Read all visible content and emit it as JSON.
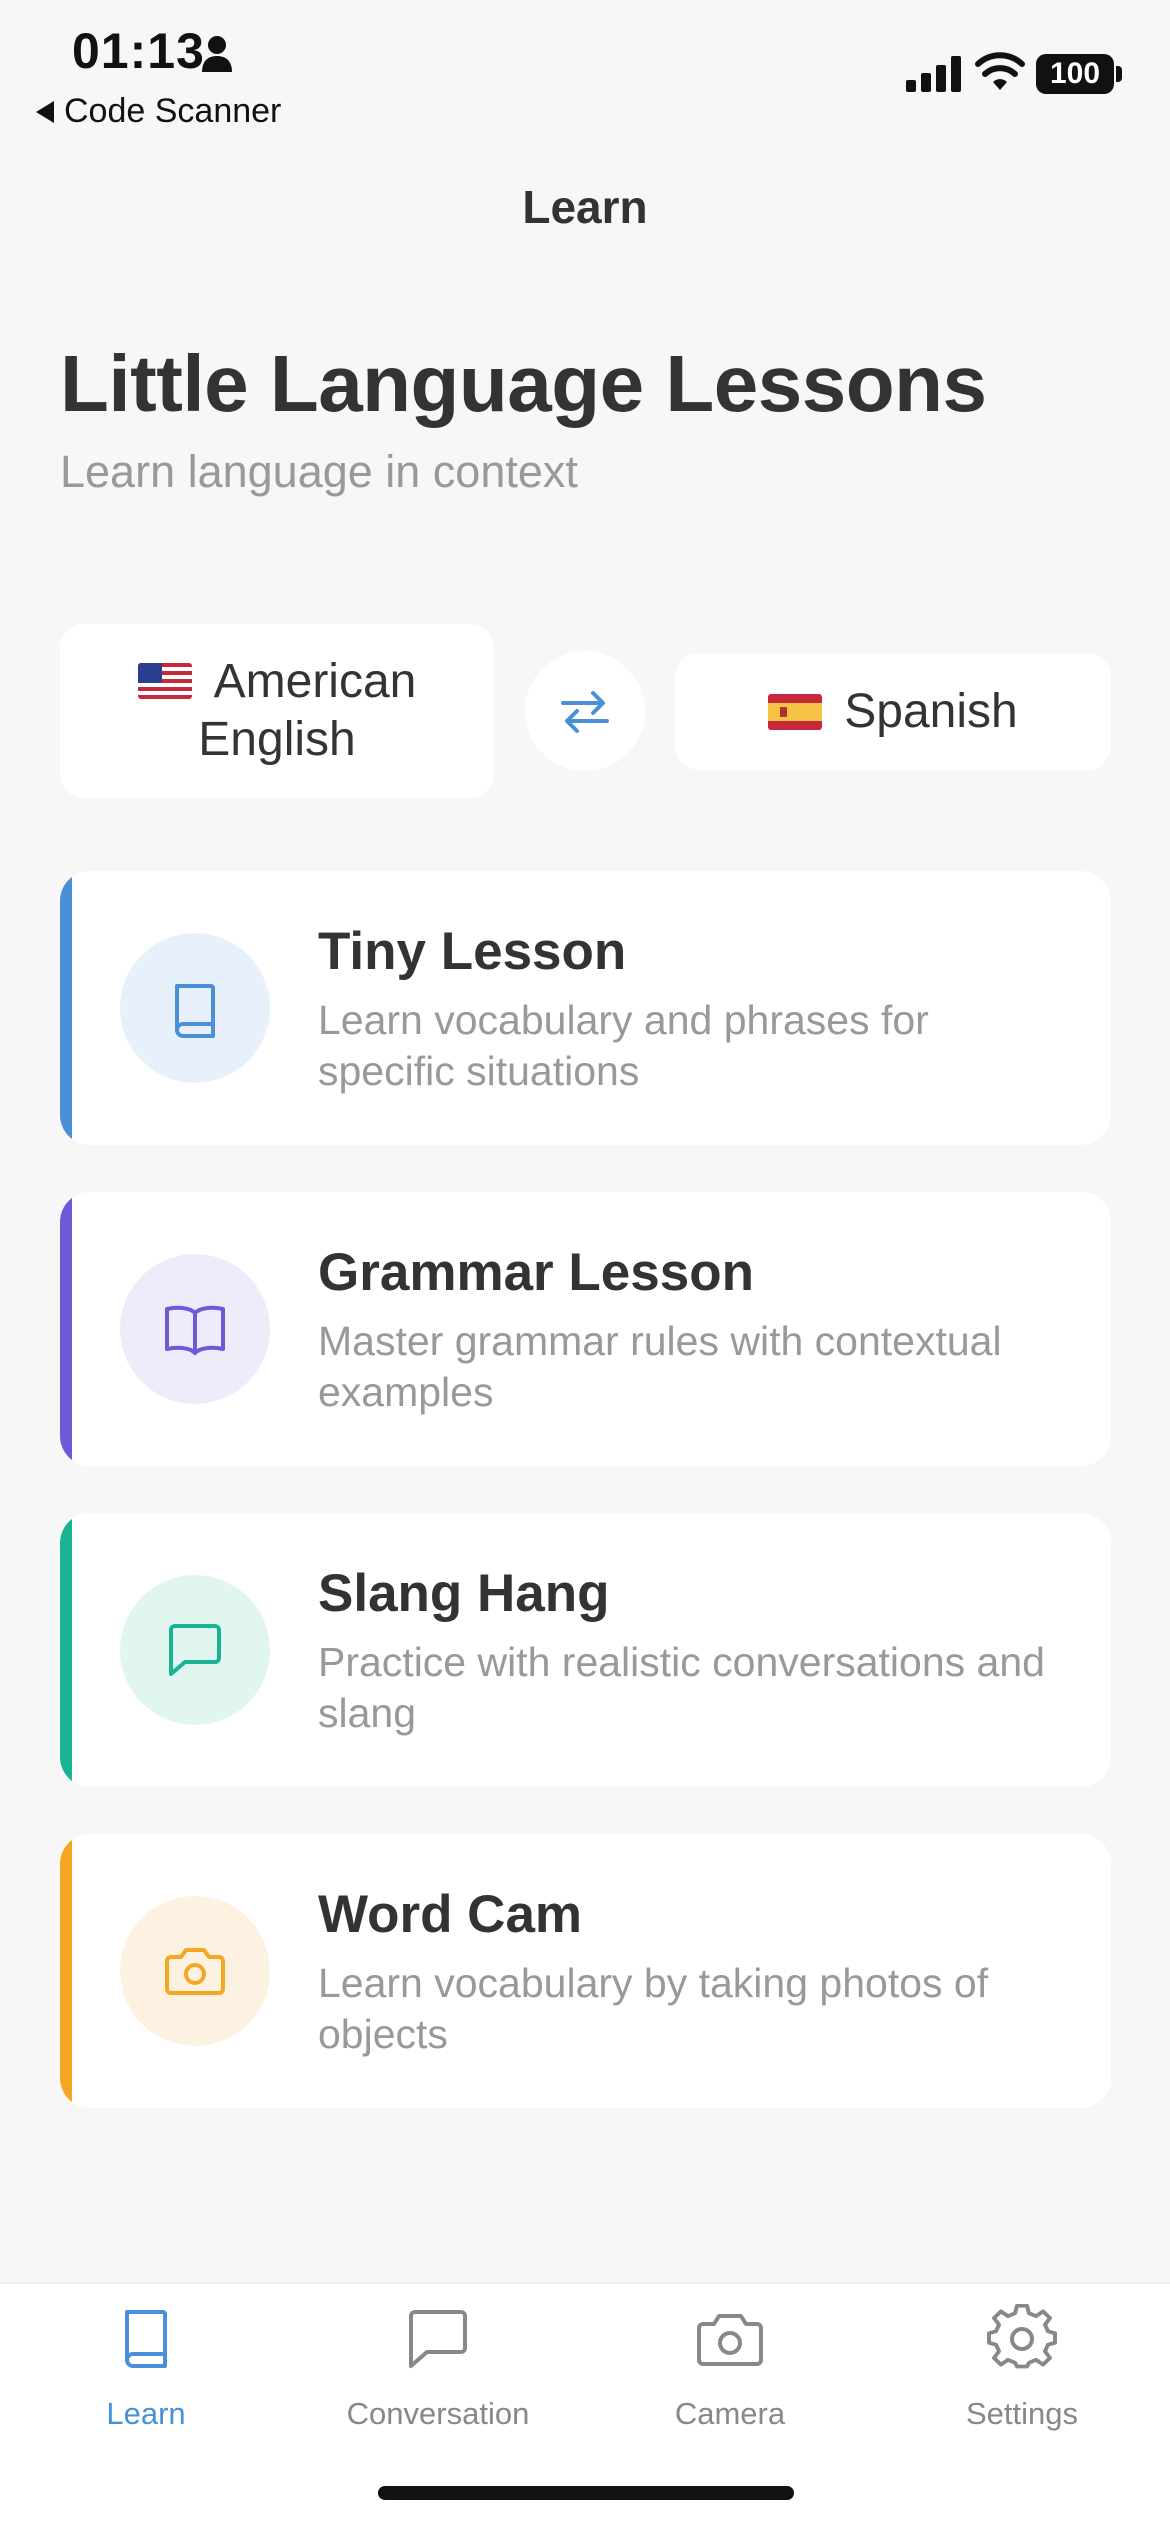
{
  "status_bar": {
    "time": "01:13",
    "back_label": "Code Scanner",
    "battery": "100"
  },
  "nav": {
    "title": "Learn"
  },
  "header": {
    "title": "Little Language Lessons",
    "subtitle": "Learn language in context"
  },
  "languages": {
    "from": {
      "label": "American English",
      "flag": "us-flag"
    },
    "to": {
      "label": "Spanish",
      "flag": "es-flag"
    },
    "swap_icon": "swap-arrows-icon"
  },
  "lessons": [
    {
      "title": "Tiny Lesson",
      "description": "Learn vocabulary and phrases for specific situations",
      "icon": "book-icon",
      "accent": "#4a90d9",
      "icon_bg": "#e8f0fb"
    },
    {
      "title": "Grammar Lesson",
      "description": "Master grammar rules with contextual examples",
      "icon": "open-book-icon",
      "accent": "#6b5bd6",
      "icon_bg": "#eeebfb"
    },
    {
      "title": "Slang Hang",
      "description": "Practice with realistic conversations and slang",
      "icon": "chat-bubble-icon",
      "accent": "#1ab394",
      "icon_bg": "#e2f6f0"
    },
    {
      "title": "Word Cam",
      "description": "Learn vocabulary by taking photos of objects",
      "icon": "camera-icon",
      "accent": "#f5a623",
      "icon_bg": "#fdf2e2"
    }
  ],
  "tabs": [
    {
      "label": "Learn",
      "icon": "book-icon",
      "active": true
    },
    {
      "label": "Conversation",
      "icon": "chat-bubble-icon",
      "active": false
    },
    {
      "label": "Camera",
      "icon": "camera-icon",
      "active": false
    },
    {
      "label": "Settings",
      "icon": "gear-icon",
      "active": false
    }
  ],
  "colors": {
    "active_tab": "#4a90d9",
    "inactive_tab": "#888888",
    "text_primary": "#333333",
    "text_secondary": "#999999"
  }
}
